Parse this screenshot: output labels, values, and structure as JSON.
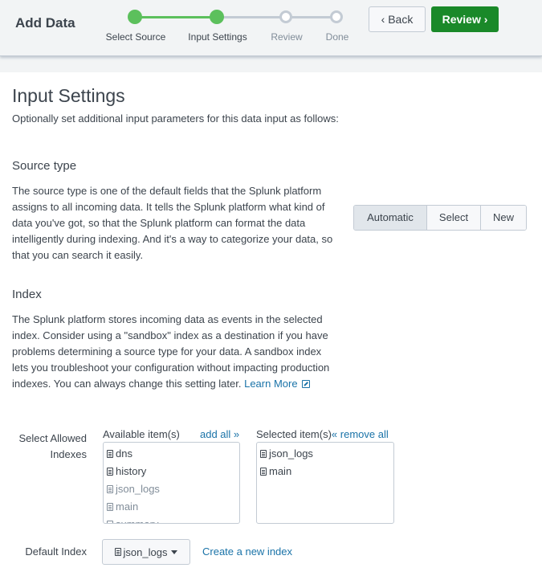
{
  "header": {
    "title": "Add Data",
    "steps": [
      {
        "label": "Select Source",
        "state": "done"
      },
      {
        "label": "Input Settings",
        "state": "current"
      },
      {
        "label": "Review",
        "state": "todo"
      },
      {
        "label": "Done",
        "state": "todo"
      }
    ],
    "back_label": "‹ Back",
    "review_label": "Review ›"
  },
  "colors": {
    "accent_green": "#1a8929",
    "step_complete": "#5cc05c",
    "link": "#1a73a8"
  },
  "page": {
    "title": "Input Settings",
    "subtitle": "Optionally set additional input parameters for this data input as follows:"
  },
  "source_type": {
    "heading": "Source type",
    "description": "The source type is one of the default fields that the Splunk platform assigns to all incoming data. It tells the Splunk platform what kind of data you've got, so that the Splunk platform can format the data intelligently during indexing. And it's a way to categorize your data, so that you can search it easily.",
    "options": [
      "Automatic",
      "Select",
      "New"
    ],
    "selected": "Automatic"
  },
  "index": {
    "heading": "Index",
    "description": "The Splunk platform stores incoming data as events in the selected index. Consider using a \"sandbox\" index as a destination if you have problems determining a source type for your data. A sandbox index lets you troubleshoot your configuration without impacting production indexes. You can always change this setting later.",
    "learn_more": "Learn More",
    "allowed_label": "Select Allowed Indexes",
    "available_header": "Available item(s)",
    "add_all": "add all »",
    "available_items": [
      {
        "name": "dns",
        "disabled": false
      },
      {
        "name": "history",
        "disabled": false
      },
      {
        "name": "json_logs",
        "disabled": true
      },
      {
        "name": "main",
        "disabled": true
      },
      {
        "name": "summary",
        "disabled": true
      }
    ],
    "selected_header": "Selected item(s)",
    "remove_all": "« remove all",
    "selected_items": [
      "json_logs",
      "main"
    ],
    "default_label": "Default Index",
    "default_value": "json_logs",
    "create_link": "Create a new index"
  }
}
